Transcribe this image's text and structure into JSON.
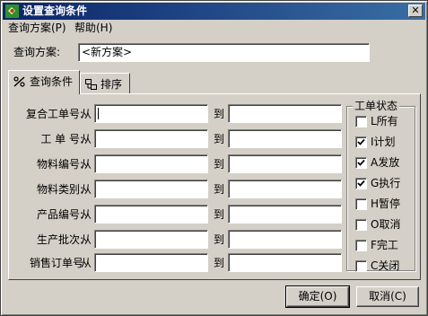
{
  "window": {
    "title": "设置查询条件",
    "close_glyph": "✕"
  },
  "menu": {
    "items": [
      {
        "label": "查询方案(P)"
      },
      {
        "label": "帮助(H)"
      }
    ]
  },
  "scheme": {
    "label": "查询方案:",
    "value": "<新方案>"
  },
  "tabs": [
    {
      "label": "查询条件",
      "icon": "filter-icon"
    },
    {
      "label": "排序",
      "icon": "sort-icon"
    }
  ],
  "conditions": {
    "from_label": "从",
    "to_label": "到",
    "rows": [
      {
        "label": "复合工单号:",
        "from": "",
        "to": ""
      },
      {
        "label": "工 单 号:",
        "from": "",
        "to": ""
      },
      {
        "label": "物料编号:",
        "from": "",
        "to": ""
      },
      {
        "label": "物料类别:",
        "from": "",
        "to": ""
      },
      {
        "label": "产品编号:",
        "from": "",
        "to": ""
      },
      {
        "label": "生产批次:",
        "from": "",
        "to": ""
      },
      {
        "label": "销售订单号",
        "from": "",
        "to": ""
      }
    ]
  },
  "status_group": {
    "title": "工单状态",
    "items": [
      {
        "label": "L所有",
        "checked": false
      },
      {
        "label": "I计划",
        "checked": true
      },
      {
        "label": "A发放",
        "checked": true
      },
      {
        "label": "G执行",
        "checked": true
      },
      {
        "label": "H暂停",
        "checked": false
      },
      {
        "label": "O取消",
        "checked": false
      },
      {
        "label": "F完工",
        "checked": false
      },
      {
        "label": "C关闭",
        "checked": false
      }
    ]
  },
  "buttons": {
    "ok": "确定(O)",
    "cancel": "取消(C)"
  }
}
